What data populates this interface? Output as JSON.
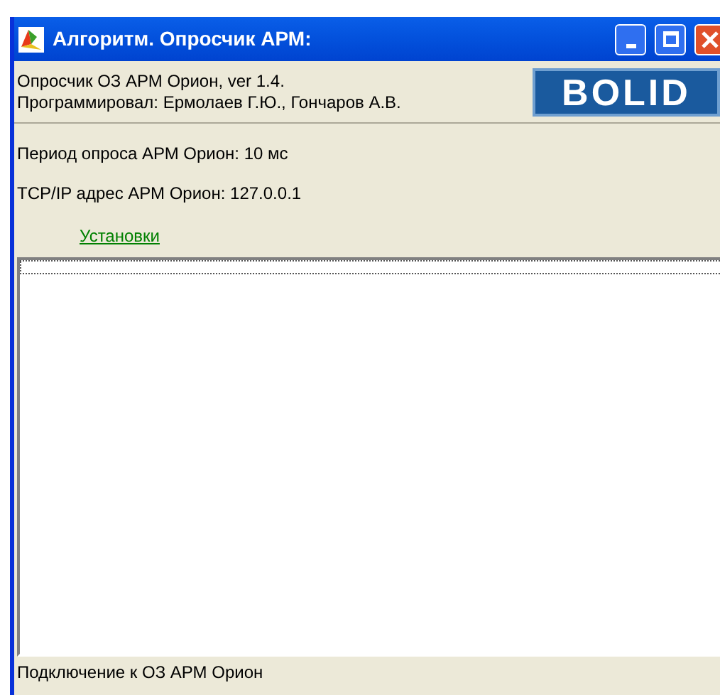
{
  "window": {
    "title": "Алгоритм. Опросчик АРМ:"
  },
  "header": {
    "lines": [
      "Опросчик ОЗ АРМ Орион, ver 1.4.",
      "Программировал: Ермолаев Г.Ю., Гончаров А.В."
    ],
    "logo": "BOLID"
  },
  "info": [
    "Период опроса АРМ Орион: 10 мс",
    "TCP/IP адрес АРМ Орион: 127.0.0.1"
  ],
  "settings_link": "Установки",
  "status_bar": "Подключение к ОЗ АРМ Орион"
}
